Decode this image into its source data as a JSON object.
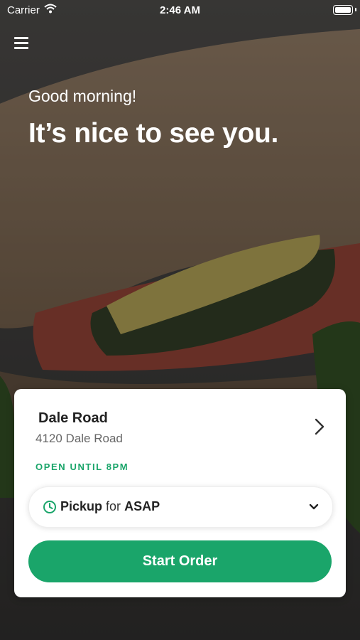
{
  "status_bar": {
    "carrier": "Carrier",
    "time": "2:46 AM"
  },
  "hero": {
    "greeting": "Good morning!",
    "headline": "It’s nice to see you."
  },
  "store": {
    "name": "Dale Road",
    "address": "4120 Dale Road",
    "hours": "OPEN UNTIL 8PM"
  },
  "order_type": {
    "mode": "Pickup",
    "connector": "for",
    "time": "ASAP"
  },
  "actions": {
    "start_order": "Start Order"
  },
  "colors": {
    "accent": "#1aa56a"
  },
  "icons": [
    "menu-icon",
    "wifi-icon",
    "battery-icon",
    "chevron-right-icon",
    "clock-icon",
    "chevron-down-icon"
  ]
}
